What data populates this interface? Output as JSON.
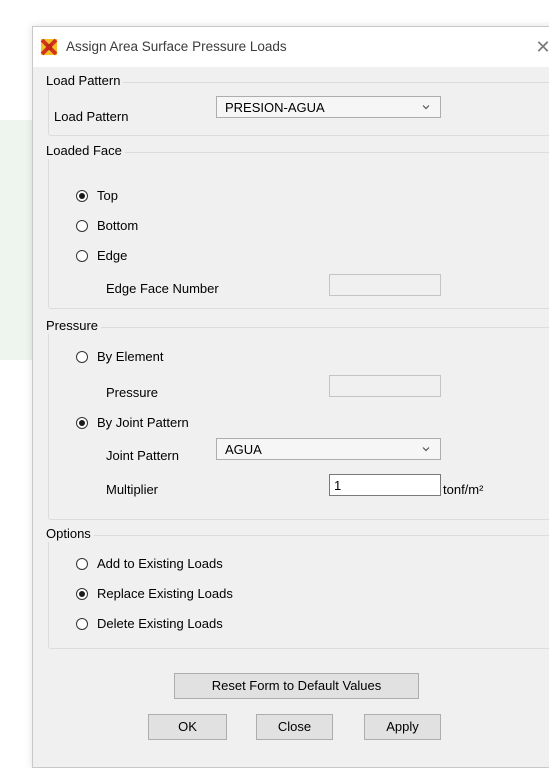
{
  "window": {
    "title": "Assign Area Surface Pressure Loads"
  },
  "load_pattern_group": {
    "title": "Load Pattern",
    "label": "Load Pattern",
    "selected": "PRESION-AGUA"
  },
  "loaded_face_group": {
    "title": "Loaded Face",
    "options": [
      "Top",
      "Bottom",
      "Edge"
    ],
    "selected": "Top",
    "edge_face_label": "Edge Face Number",
    "edge_face_value": ""
  },
  "pressure_group": {
    "title": "Pressure",
    "by_element_label": "By Element",
    "pressure_label": "Pressure",
    "pressure_value": "",
    "by_joint_label": "By Joint Pattern",
    "selected": "By Joint Pattern",
    "joint_pattern_label": "Joint Pattern",
    "joint_pattern_selected": "AGUA",
    "multiplier_label": "Multiplier",
    "multiplier_value": "1",
    "multiplier_unit": "tonf/m²"
  },
  "options_group": {
    "title": "Options",
    "options": [
      "Add to Existing Loads",
      "Replace Existing Loads",
      "Delete Existing Loads"
    ],
    "selected": "Replace Existing Loads"
  },
  "buttons": {
    "reset": "Reset Form to Default Values",
    "ok": "OK",
    "close": "Close",
    "apply": "Apply"
  }
}
